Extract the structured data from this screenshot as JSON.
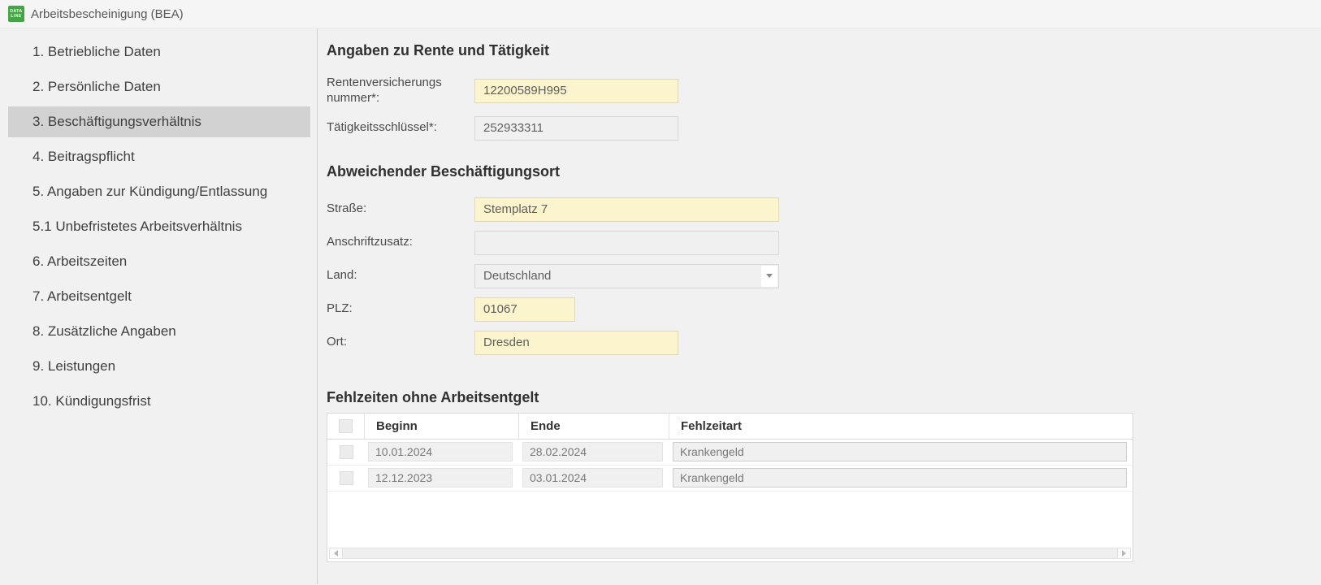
{
  "window": {
    "title": "Arbeitsbescheinigung (BEA)",
    "logo_line1": "DATA",
    "logo_line2": "LINE"
  },
  "sidebar": {
    "selected_index": 2,
    "items": [
      {
        "label": "1. Betriebliche Daten"
      },
      {
        "label": "2. Persönliche Daten"
      },
      {
        "label": "3. Beschäftigungsverhältnis"
      },
      {
        "label": "4. Beitragspflicht"
      },
      {
        "label": "5. Angaben zur Kündigung/Entlassung"
      },
      {
        "label": "5.1 Unbefristetes Arbeitsverhältnis"
      },
      {
        "label": "6. Arbeitszeiten"
      },
      {
        "label": "7. Arbeitsentgelt"
      },
      {
        "label": "8. Zusätzliche Angaben"
      },
      {
        "label": "9. Leistungen"
      },
      {
        "label": "10. Kündigungsfrist"
      }
    ]
  },
  "sections": {
    "rente": {
      "heading": "Angaben zu Rente und Tätigkeit",
      "rv_label": "Rentenversicherungs nummer*:",
      "rv_value": "12200589H995",
      "ts_label": "Tätigkeitsschlüssel*:",
      "ts_value": "252933311"
    },
    "ort": {
      "heading": "Abweichender Beschäftigungsort",
      "strasse_label": "Straße:",
      "strasse_value": "Stemplatz 7",
      "anschrift_label": "Anschriftzusatz:",
      "anschrift_value": "",
      "land_label": "Land:",
      "land_value": "Deutschland",
      "plz_label": "PLZ:",
      "plz_value": "01067",
      "ort_label": "Ort:",
      "ort_value": "Dresden"
    },
    "fehlzeiten": {
      "heading": "Fehlzeiten ohne Arbeitsentgelt",
      "columns": {
        "beginn": "Beginn",
        "ende": "Ende",
        "fehlzeitart": "Fehlzeitart"
      },
      "rows": [
        {
          "beginn": "10.01.2024",
          "ende": "28.02.2024",
          "fehlzeitart": "Krankengeld"
        },
        {
          "beginn": "12.12.2023",
          "ende": "03.01.2024",
          "fehlzeitart": "Krankengeld"
        }
      ]
    }
  },
  "colors": {
    "accent_green": "#44a544",
    "field_yellow": "#fbf4cd",
    "selected_gray": "#d2d2d2"
  }
}
